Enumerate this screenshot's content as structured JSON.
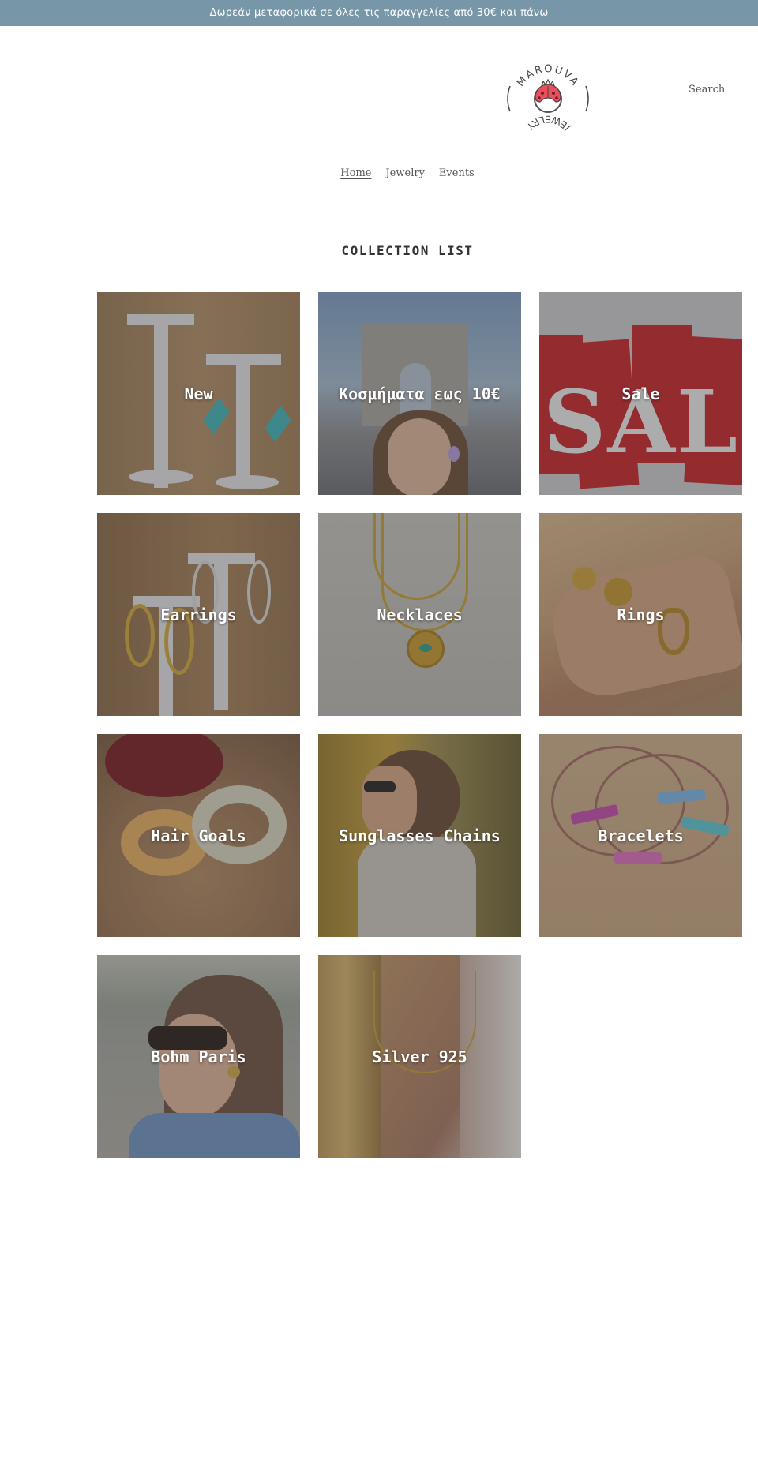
{
  "announcement": {
    "text": "Δωρεάν μεταφορικά σε όλες τις παραγγελίες από 30€ και πάνω",
    "background": "#7796a8"
  },
  "header": {
    "logo": {
      "top_text": "MAROUVA",
      "bottom_text": "JEWELRY",
      "icon": "ladybug-ring-icon",
      "accent_color": "#e8505b"
    },
    "search_label": "Search",
    "nav": [
      {
        "label": "Home",
        "active": true
      },
      {
        "label": "Jewelry",
        "active": false
      },
      {
        "label": "Events",
        "active": false
      }
    ]
  },
  "collection_list": {
    "title": "COLLECTION LIST",
    "items": [
      {
        "label": "New",
        "image": "earrings-on-stands"
      },
      {
        "label": "Κοσμήματα εως 10€",
        "image": "woman-at-arc-de-triomphe"
      },
      {
        "label": "Sale",
        "image": "red-sale-tags"
      },
      {
        "label": "Earrings",
        "image": "hoop-earrings-on-stands"
      },
      {
        "label": "Necklaces",
        "image": "gold-medallion-necklace"
      },
      {
        "label": "Rings",
        "image": "hand-with-gold-rings"
      },
      {
        "label": "Hair Goals",
        "image": "floral-scrunchies"
      },
      {
        "label": "Sunglasses Chains",
        "image": "woman-with-sunglasses-chain"
      },
      {
        "label": "Bracelets",
        "image": "cord-bracelets"
      },
      {
        "label": "Bohm Paris",
        "image": "woman-with-sunglasses-by-lake"
      },
      {
        "label": "Silver 925",
        "image": "gold-necklace-on-neck"
      }
    ]
  }
}
